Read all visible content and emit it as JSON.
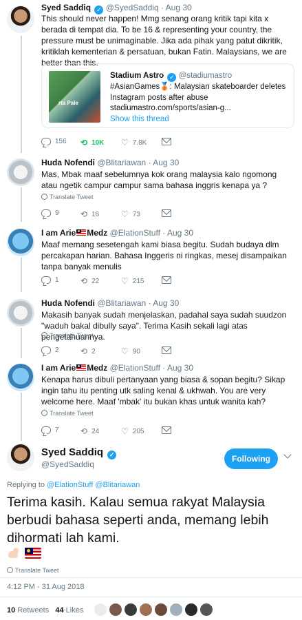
{
  "quoted_tweet": {
    "author_name": "Syed Saddiq",
    "author_handle": "@SyedSaddiq",
    "date": "Aug 30",
    "text": "This should never happen! Mmg senang orang kritik tapi kita x berada di tempat dia. To be 16 & representing your country, the pressure must be unimaginable. Jika ada pihak yang patut dikritik, kritiklah kementerian & persatuan, bukan Fatin. Malaysians, we are better than this.",
    "card": {
      "image_text": "rta Pale",
      "name": "Stadium Astro",
      "handle": "@stadiumastro",
      "text": "#AsianGames🥉: Malaysian skateboarder deletes Instagram posts after abuse",
      "link": "stadiumastro.com/sports/asian-g...",
      "show_thread": "Show this thread"
    },
    "replies": "156",
    "retweets": "10K",
    "likes": "7.8K"
  },
  "replies": [
    {
      "author_name": "Huda Nofendi",
      "author_handle": "@Blitariawan",
      "date": "Aug 30",
      "text": "Mas, Mbak maaf sebelumnya  kok orang malaysia kalo ngomong atau ngetik campur campur sama bahasa inggris kenapa ya ?",
      "translate": "Translate Tweet",
      "replies": "9",
      "retweets": "16",
      "likes": "73"
    },
    {
      "author_name_a": "I am Arie",
      "author_name_b": "Medz",
      "author_handle": "@ElationStuff",
      "date": "Aug 30",
      "text": "Maaf memang sesetengah kami biasa begitu. Sudah budaya dlm percakapan harian. Bahasa Inggeris ni ringkas, mesej disampaikan tanpa banyak menulis",
      "replies": "1",
      "retweets": "22",
      "likes": "215"
    },
    {
      "author_name": "Huda Nofendi",
      "author_handle": "@Blitariawan",
      "date": "Aug 30",
      "text": "Makasih banyak sudah menjelaskan,  padahal saya sudah suudzon \"waduh bakal dibully saya\". Terima Kasih sekali lagi atas pengetahuannya.",
      "translate": "Translate Tweet",
      "replies": "2",
      "retweets": "2",
      "likes": "90"
    },
    {
      "author_name_a": "I am Arie",
      "author_name_b": "Medz",
      "author_handle": "@ElationStuff",
      "date": "Aug 30",
      "text": "Kenapa harus dibuli pertanyaan yang biasa & sopan begitu? Sikap ingin tahu itu penting utk saling kenal & ukhwah. You are very welcome here. Maaf 'mbak' itu bukan khas untuk wanita kah?",
      "translate": "Translate Tweet",
      "replies": "7",
      "retweets": "24",
      "likes": "205"
    }
  ],
  "main_tweet": {
    "author_name": "Syed Saddiq",
    "author_handle": "@SyedSaddiq",
    "follow_label": "Following",
    "replying_prefix": "Replying to",
    "replying_to_1": "@ElationStuff",
    "replying_to_2": "@Blitariawan",
    "text": "Terima kasih. Kalau semua rakyat Malaysia berbudi bahasa seperti anda, memang lebih dihormati lah kami.",
    "translate": "Translate Tweet",
    "timestamp": "4:12 PM - 31 Aug 2018",
    "retweet_count": "10",
    "retweet_label": "Retweets",
    "like_count": "44",
    "like_label": "Likes"
  },
  "colors": {
    "accent": "#1da1f2",
    "retweet_active": "#17bf63",
    "muted": "#657786"
  },
  "icons": [
    "reply-icon",
    "retweet-icon",
    "like-icon",
    "dm-icon",
    "verified-badge-icon",
    "malaysia-flag-icon",
    "flexed-biceps-icon",
    "globe-icon",
    "chevron-down-icon"
  ]
}
